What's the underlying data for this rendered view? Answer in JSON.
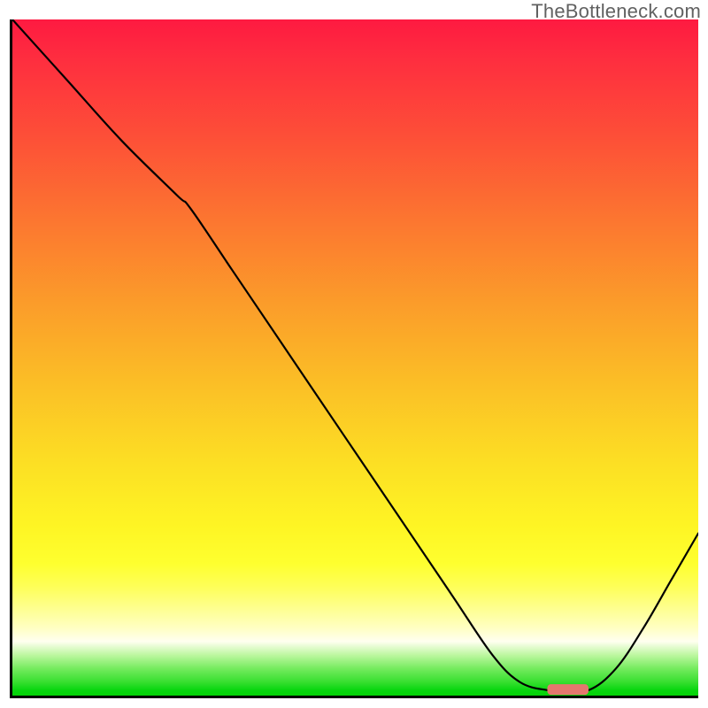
{
  "watermark": "TheBottleneck.com",
  "chart_data": {
    "type": "line",
    "title": "",
    "xlabel": "",
    "ylabel": "",
    "xlim": [
      0,
      100
    ],
    "ylim": [
      0,
      100
    ],
    "notes": "Gradient background from red (top, high mismatch) to green (bottom, no bottleneck). Black curve shows bottleneck percentage vs. component index; minimum/optimal region highlighted by a short pink bar near x≈78–84.",
    "series": [
      {
        "name": "bottleneck-curve",
        "x": [
          0,
          8,
          16,
          24,
          26,
          32,
          40,
          48,
          56,
          64,
          70,
          74,
          78,
          80,
          84,
          88,
          92,
          96,
          100
        ],
        "y": [
          100,
          91,
          82,
          74,
          72,
          63,
          51,
          39,
          27,
          15,
          6,
          2,
          0.8,
          0.8,
          0.8,
          4,
          10,
          17,
          24
        ]
      }
    ],
    "highlight_segment": {
      "x_start": 78,
      "x_end": 84,
      "y": 0.9
    },
    "gradient_stops": [
      {
        "pos": 0,
        "color": "#fe1a41"
      },
      {
        "pos": 0.5,
        "color": "#fbbf26"
      },
      {
        "pos": 0.8,
        "color": "#feff2f"
      },
      {
        "pos": 0.93,
        "color": "#bdf7a0"
      },
      {
        "pos": 1.0,
        "color": "#03d407"
      }
    ]
  }
}
